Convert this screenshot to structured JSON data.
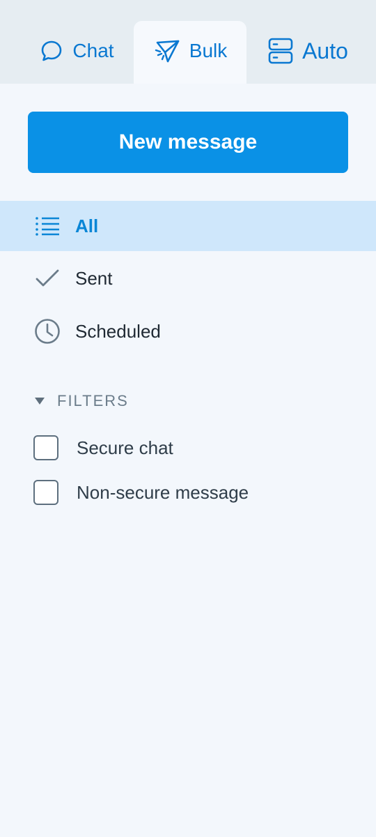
{
  "tabs": [
    {
      "label": "Chat",
      "icon": "chat-bubble-icon",
      "active": false
    },
    {
      "label": "Bulk",
      "icon": "paper-plane-icon",
      "active": true
    },
    {
      "label": "Auto",
      "icon": "server-icon",
      "active": false
    }
  ],
  "actions": {
    "new_message_label": "New message"
  },
  "nav": {
    "items": [
      {
        "label": "All",
        "icon": "list-icon",
        "selected": true
      },
      {
        "label": "Sent",
        "icon": "check-icon",
        "selected": false
      },
      {
        "label": "Scheduled",
        "icon": "clock-icon",
        "selected": false
      }
    ]
  },
  "filters": {
    "header": "FILTERS",
    "expanded": true,
    "options": [
      {
        "label": "Secure chat",
        "checked": false
      },
      {
        "label": "Non-secure message",
        "checked": false
      }
    ]
  },
  "colors": {
    "accent": "#0a91e6",
    "selected_background": "#cfe7fb",
    "tabbar_background": "#e6edf2",
    "page_background": "#f3f7fc"
  }
}
